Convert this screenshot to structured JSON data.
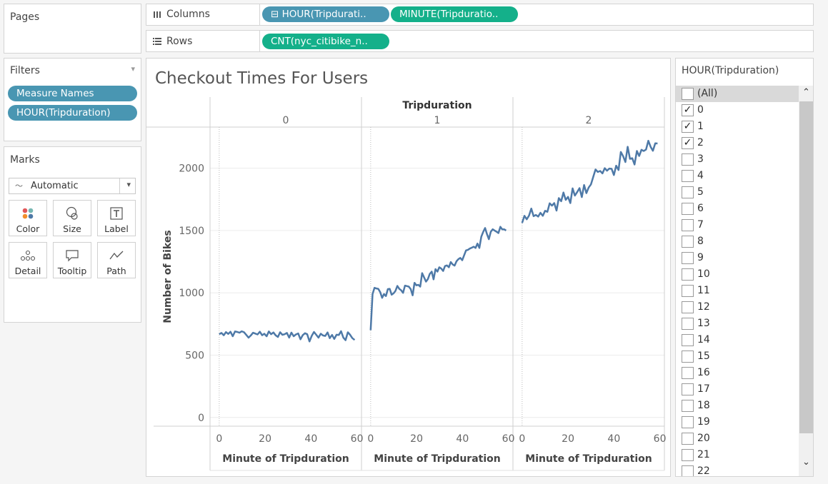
{
  "pages": {
    "title": "Pages"
  },
  "columns_shelf": {
    "label": "Columns",
    "pills": [
      "⊟ HOUR(Tripdurati..",
      "MINUTE(Tripduratio.."
    ]
  },
  "rows_shelf": {
    "label": "Rows",
    "pills": [
      "CNT(nyc_citibike_n.."
    ]
  },
  "filters": {
    "title": "Filters",
    "pills": [
      "Measure Names",
      "HOUR(Tripduration)"
    ]
  },
  "marks": {
    "title": "Marks",
    "type": "Automatic",
    "buttons": [
      "Color",
      "Size",
      "Label",
      "Detail",
      "Tooltip",
      "Path"
    ]
  },
  "view": {
    "title": "Checkout Times For Users"
  },
  "chart_data": {
    "type": "line",
    "header": "Tripduration",
    "panels": [
      "0",
      "1",
      "2"
    ],
    "xlabel": "Minute of Tripduration",
    "ylabel": "Number of Bikes",
    "xticks": [
      0,
      20,
      40,
      60
    ],
    "yticks": [
      0,
      500,
      1000,
      1500,
      2000
    ],
    "xlim": [
      -4,
      62
    ],
    "ylim": [
      -70,
      2330
    ],
    "grid": true,
    "color": "#4e79a7",
    "series": [
      {
        "values": [
          668,
          678,
          660,
          685,
          670,
          688,
          652,
          690,
          686,
          680,
          691,
          684,
          662,
          640,
          658,
          680,
          673,
          666,
          688,
          660,
          672,
          651,
          690,
          668,
          682,
          659,
          646,
          684,
          663,
          668,
          678,
          641,
          681,
          652,
          666,
          674,
          627,
          660,
          676,
          668,
          610,
          655,
          686,
          663,
          640,
          672,
          658,
          654,
          682,
          636,
          662,
          630,
          664,
          662,
          692,
          641,
          620,
          683,
          664,
          636,
          622
        ]
      },
      {
        "values": [
          700,
          990,
          1040,
          1035,
          1032,
          1005,
          960,
          990,
          974,
          1030,
          1032,
          985,
          996,
          1015,
          1055,
          1032,
          1020,
          1000,
          1058,
          1054,
          1050,
          1030,
          980,
          1080,
          1060,
          1064,
          1050,
          1158,
          1124,
          1090,
          1110,
          1152,
          1170,
          1108,
          1190,
          1170,
          1205,
          1195,
          1175,
          1215,
          1220,
          1205,
          1247,
          1228,
          1218,
          1253,
          1270,
          1280,
          1262,
          1300,
          1340,
          1345,
          1355,
          1362,
          1370,
          1360,
          1395,
          1360,
          1450,
          1488,
          1520,
          1470,
          1430,
          1490,
          1510,
          1500,
          1490,
          1480,
          1530,
          1510,
          1510,
          1500
        ]
      },
      {
        "values": [
          1560,
          1618,
          1590,
          1620,
          1676,
          1615,
          1625,
          1612,
          1642,
          1618,
          1658,
          1650,
          1718,
          1700,
          1720,
          1660,
          1760,
          1735,
          1805,
          1746,
          1770,
          1720,
          1838,
          1780,
          1808,
          1840,
          1768,
          1865,
          1800,
          1845,
          1870,
          1930,
          1990,
          1970,
          1978,
          1958,
          2000,
          1980,
          1997,
          1995,
          1945,
          2020,
          1985,
          2130,
          2097,
          2050,
          2172,
          2075,
          2080,
          2030,
          2138,
          2098,
          2148,
          2138,
          2150,
          2220,
          2172,
          2140,
          2200,
          2198
        ]
      }
    ]
  },
  "filter_card": {
    "title": "HOUR(Tripduration)",
    "items": [
      {
        "label": "(All)",
        "checked": false
      },
      {
        "label": "0",
        "checked": true
      },
      {
        "label": "1",
        "checked": true
      },
      {
        "label": "2",
        "checked": true
      },
      {
        "label": "3",
        "checked": false
      },
      {
        "label": "4",
        "checked": false
      },
      {
        "label": "5",
        "checked": false
      },
      {
        "label": "6",
        "checked": false
      },
      {
        "label": "7",
        "checked": false
      },
      {
        "label": "8",
        "checked": false
      },
      {
        "label": "9",
        "checked": false
      },
      {
        "label": "10",
        "checked": false
      },
      {
        "label": "11",
        "checked": false
      },
      {
        "label": "12",
        "checked": false
      },
      {
        "label": "13",
        "checked": false
      },
      {
        "label": "14",
        "checked": false
      },
      {
        "label": "15",
        "checked": false
      },
      {
        "label": "16",
        "checked": false
      },
      {
        "label": "17",
        "checked": false
      },
      {
        "label": "18",
        "checked": false
      },
      {
        "label": "19",
        "checked": false
      },
      {
        "label": "20",
        "checked": false
      },
      {
        "label": "21",
        "checked": false
      },
      {
        "label": "22",
        "checked": false
      }
    ],
    "check_glyph": "✓"
  },
  "icons": {
    "up": "⌃",
    "down": "⌄",
    "dropdown": "▾",
    "marks_type": "〜"
  }
}
